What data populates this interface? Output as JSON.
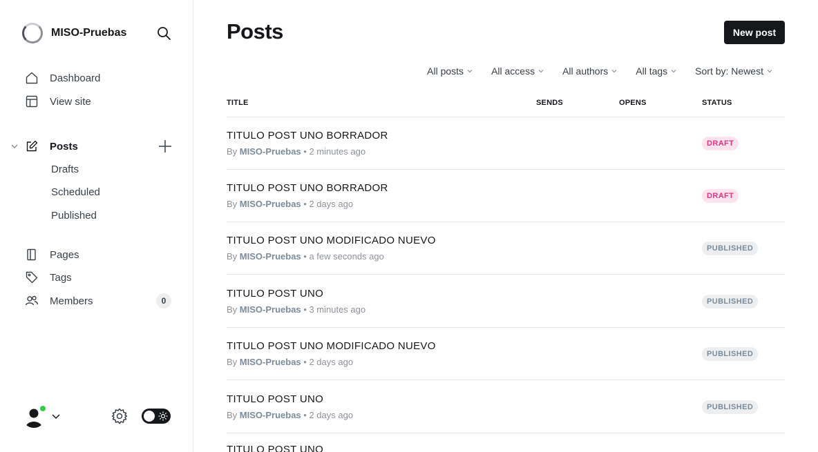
{
  "brand": {
    "name": "MISO-Pruebas"
  },
  "nav": {
    "dashboard": "Dashboard",
    "view_site": "View site",
    "posts": "Posts",
    "drafts": "Drafts",
    "scheduled": "Scheduled",
    "published": "Published",
    "pages": "Pages",
    "tags": "Tags",
    "members": "Members",
    "members_count": "0"
  },
  "header": {
    "title": "Posts",
    "new_post": "New post"
  },
  "filters": [
    "All posts",
    "All access",
    "All authors",
    "All tags",
    "Sort by: Newest"
  ],
  "columns": {
    "title": "TITLE",
    "sends": "SENDS",
    "opens": "OPENS",
    "status": "STATUS"
  },
  "posts": [
    {
      "title": "TITULO POST UNO BORRADOR",
      "by": "By",
      "author": "MISO-Pruebas",
      "time": "• 2 minutes ago",
      "status": "DRAFT",
      "status_type": "draft"
    },
    {
      "title": "TITULO POST UNO BORRADOR",
      "by": "By",
      "author": "MISO-Pruebas",
      "time": "• 2 days ago",
      "status": "DRAFT",
      "status_type": "draft"
    },
    {
      "title": "TITULO POST UNO MODIFICADO NUEVO",
      "by": "By",
      "author": "MISO-Pruebas",
      "time": "• a few seconds ago",
      "status": "PUBLISHED",
      "status_type": "published"
    },
    {
      "title": "TITULO POST UNO",
      "by": "By",
      "author": "MISO-Pruebas",
      "time": "• 3 minutes ago",
      "status": "PUBLISHED",
      "status_type": "published"
    },
    {
      "title": "TITULO POST UNO MODIFICADO NUEVO",
      "by": "By",
      "author": "MISO-Pruebas",
      "time": "• 2 days ago",
      "status": "PUBLISHED",
      "status_type": "published"
    },
    {
      "title": "TITULO POST UNO",
      "by": "By",
      "author": "MISO-Pruebas",
      "time": "• 2 days ago",
      "status": "PUBLISHED",
      "status_type": "published"
    },
    {
      "title": "TITULO POST UNO"
    }
  ],
  "colors": {
    "draft": "#e5337f",
    "published": "#7c8b9a",
    "primary_button": "#15171a",
    "online": "#30cf43"
  },
  "icons": [
    "site-logo-icon",
    "search-icon",
    "home-icon",
    "layout-icon",
    "edit-icon",
    "chevron-down-icon",
    "plus-icon",
    "page-icon",
    "tag-icon",
    "members-icon",
    "user-avatar-icon",
    "gear-icon",
    "sun-icon"
  ]
}
